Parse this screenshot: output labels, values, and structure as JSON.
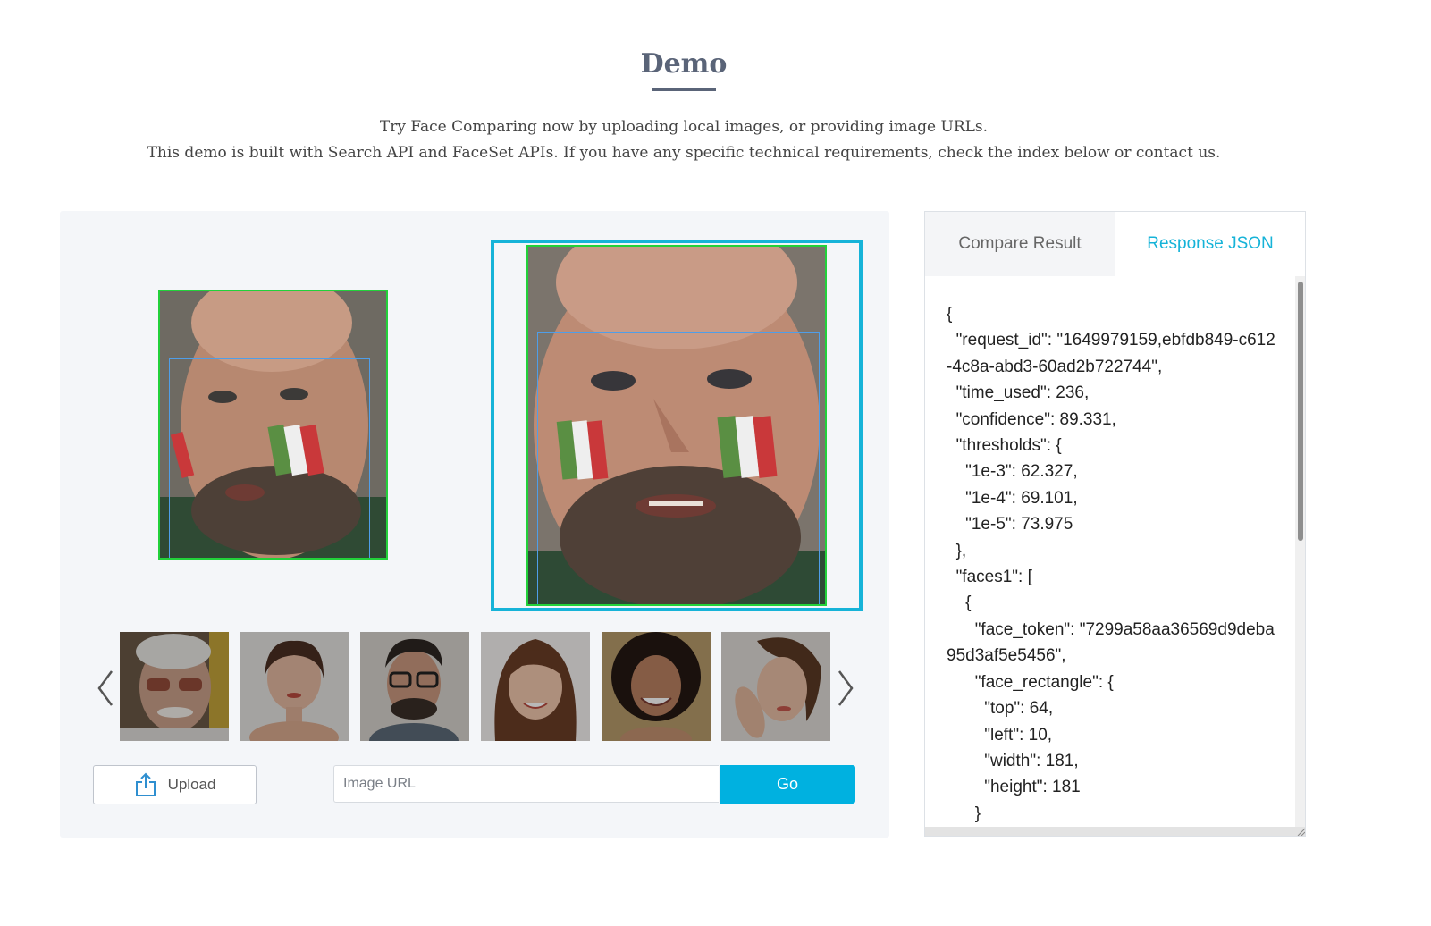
{
  "header": {
    "title": "Demo",
    "subtitle_line1": "Try Face Comparing now by uploading local images, or providing image URLs.",
    "subtitle_line2": "This demo is built with Search API and FaceSet APIs. If you have any specific technical requirements, check the index below or contact us."
  },
  "controls": {
    "upload_label": "Upload",
    "url_placeholder": "Image URL",
    "url_value": "",
    "go_label": "Go"
  },
  "thumbnails": [
    {
      "name": "thumb-elderly-man",
      "color": "#8a6a55"
    },
    {
      "name": "thumb-woman-short-hair",
      "color": "#a0877a"
    },
    {
      "name": "thumb-man-glasses",
      "color": "#7a6a60"
    },
    {
      "name": "thumb-girl-smiling",
      "color": "#b79a86"
    },
    {
      "name": "thumb-woman-curly-hair",
      "color": "#6a5a48"
    },
    {
      "name": "thumb-woman-hand-face",
      "color": "#a88470"
    }
  ],
  "tabs": {
    "compare": "Compare Result",
    "json": "Response JSON",
    "active": "json"
  },
  "response_json": "{\n  \"request_id\": \"1649979159,ebfdb849-c612-4c8a-abd3-60ad2b722744\",\n  \"time_used\": 236,\n  \"confidence\": 89.331,\n  \"thresholds\": {\n    \"1e-3\": 62.327,\n    \"1e-4\": 69.101,\n    \"1e-5\": 73.975\n  },\n  \"faces1\": [\n    {\n      \"face_token\": \"7299a58aa36569d9deba95d3af5e5456\",\n      \"face_rectangle\": {\n        \"top\": 64,\n        \"left\": 10,\n        \"width\": 181,\n        \"height\": 181\n      }\n    }\n  ]",
  "colors": {
    "accent": "#16b3d8",
    "face_match_border": "#22d13a",
    "face_box": "#4f9ee8",
    "go_button": "#00b1e0"
  }
}
